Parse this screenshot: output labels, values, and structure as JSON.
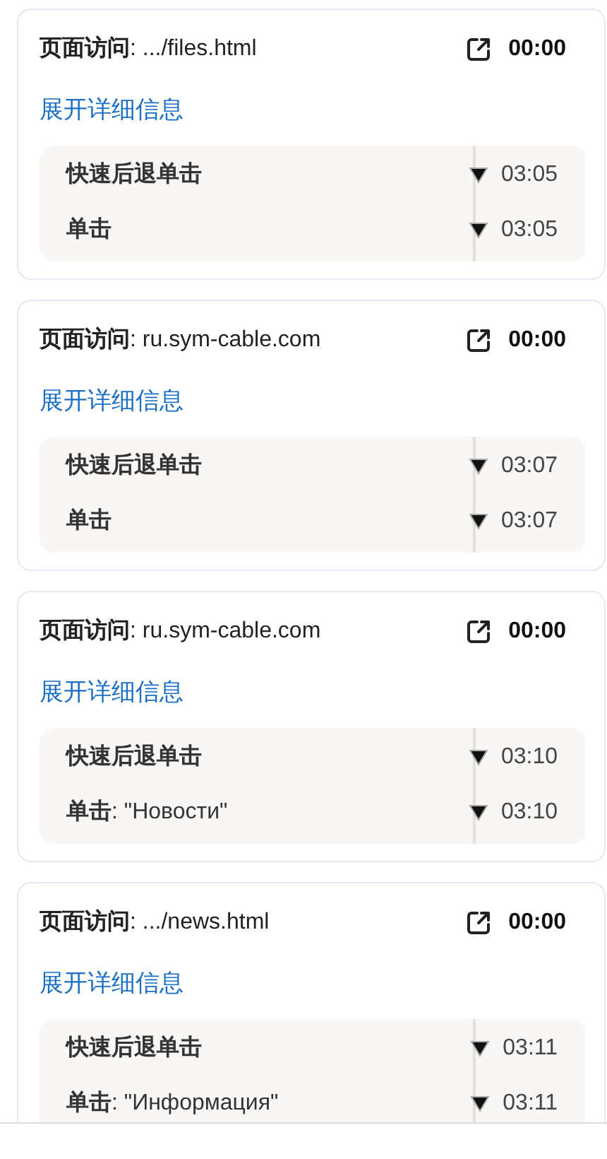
{
  "visits": [
    {
      "title": "**页面访问**: .../files.html",
      "time": "00:00",
      "expand_link": "展开详细信息",
      "events": [
        {
          "text": "快速后退单击",
          "time": "03:05"
        },
        {
          "text": "**单击**",
          "time": "03:05"
        }
      ]
    },
    {
      "title": "**页面访问**: ru.sym-cable.com",
      "time": "00:00",
      "expand_link": "展开详细信息",
      "events": [
        {
          "text": "快速后退单击",
          "time": "03:07"
        },
        {
          "text": "**单击**",
          "time": "03:07"
        }
      ]
    },
    {
      "title": "**页面访问**: ru.sym-cable.com",
      "time": "00:00",
      "expand_link": "展开详细信息",
      "events": [
        {
          "text": "快速后退单击",
          "time": "03:10"
        },
        {
          "text": "**单击**: \"Новости\"",
          "time": "03:10"
        }
      ]
    },
    {
      "title": "**页面访问**: .../news.html",
      "time": "00:00",
      "expand_link": "展开详细信息",
      "events": [
        {
          "text": "快速后退单击",
          "time": "03:11"
        },
        {
          "text": "**单击**: \"Информация\"",
          "time": "03:11"
        }
      ]
    }
  ]
}
